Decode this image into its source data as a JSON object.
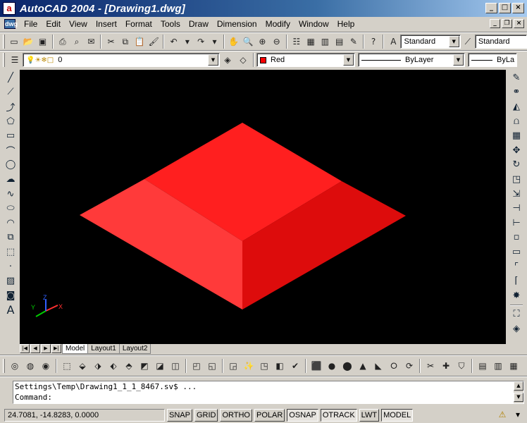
{
  "window": {
    "title": "AutoCAD 2004 - [Drawing1.dwg]"
  },
  "menu": [
    "File",
    "Edit",
    "View",
    "Insert",
    "Format",
    "Tools",
    "Draw",
    "Dimension",
    "Modify",
    "Window",
    "Help"
  ],
  "toolbar": {
    "text_style": "Standard",
    "dim_style": "Standard",
    "layer": "0",
    "color": "Red",
    "linetype": "ByLayer",
    "lineweight": "ByLa"
  },
  "colors": {
    "object": "#ff2020",
    "background": "#000000",
    "title_bar": "#0a246a"
  },
  "ucs": {
    "x": "X",
    "y": "Y",
    "z": "Z"
  },
  "tabs": [
    "Model",
    "Layout1",
    "Layout2"
  ],
  "command": {
    "history": "Settings\\Temp\\Drawing1_1_1_8467.sv$ ...",
    "prompt": "Command:"
  },
  "status": {
    "coords": "24.7081, -14.8283, 0.0000",
    "buttons": [
      "SNAP",
      "GRID",
      "ORTHO",
      "POLAR",
      "OSNAP",
      "OTRACK",
      "LWT",
      "MODEL"
    ]
  }
}
